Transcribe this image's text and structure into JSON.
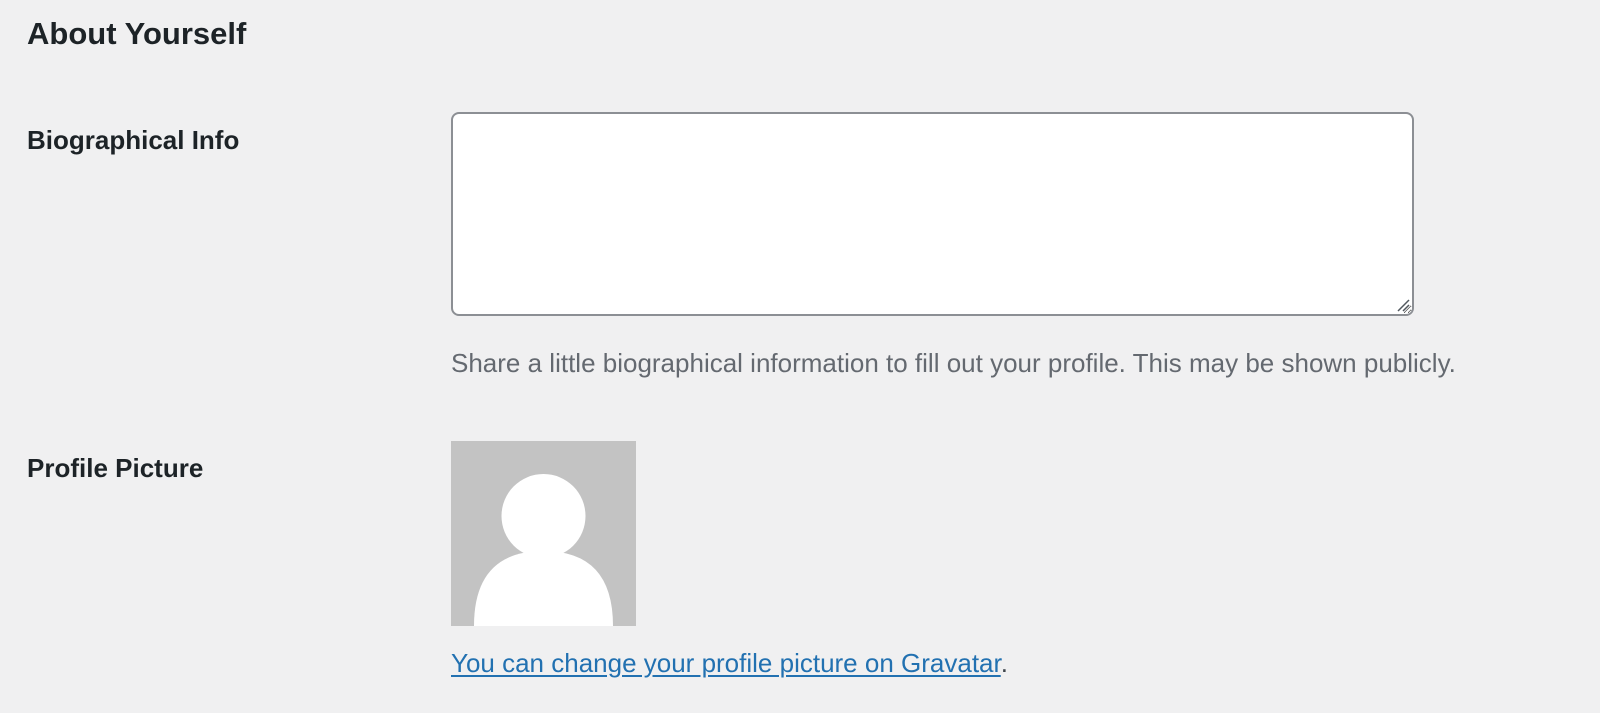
{
  "section": {
    "title": "About Yourself"
  },
  "bio": {
    "label": "Biographical Info",
    "value": "",
    "description": "Share a little biographical information to fill out your profile. This may be shown publicly."
  },
  "profile_picture": {
    "label": "Profile Picture",
    "avatar_icon": "default-person-avatar",
    "link_text": "You can change your profile picture on Gravatar",
    "link_suffix": ".",
    "colors": {
      "avatar_bg": "#c3c3c3",
      "link": "#2271b1"
    }
  }
}
